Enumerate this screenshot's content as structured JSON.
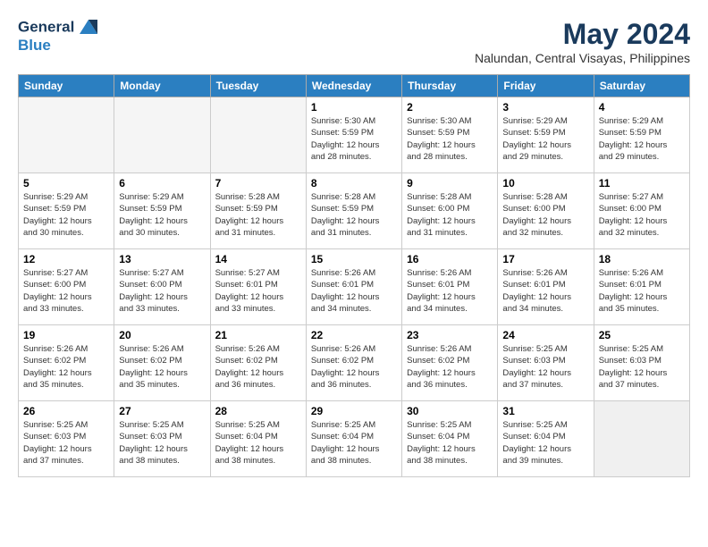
{
  "logo": {
    "line1": "General",
    "line2": "Blue"
  },
  "title": "May 2024",
  "location": "Nalundan, Central Visayas, Philippines",
  "days_of_week": [
    "Sunday",
    "Monday",
    "Tuesday",
    "Wednesday",
    "Thursday",
    "Friday",
    "Saturday"
  ],
  "weeks": [
    [
      {
        "day": "",
        "info": ""
      },
      {
        "day": "",
        "info": ""
      },
      {
        "day": "",
        "info": ""
      },
      {
        "day": "1",
        "info": "Sunrise: 5:30 AM\nSunset: 5:59 PM\nDaylight: 12 hours\nand 28 minutes."
      },
      {
        "day": "2",
        "info": "Sunrise: 5:30 AM\nSunset: 5:59 PM\nDaylight: 12 hours\nand 28 minutes."
      },
      {
        "day": "3",
        "info": "Sunrise: 5:29 AM\nSunset: 5:59 PM\nDaylight: 12 hours\nand 29 minutes."
      },
      {
        "day": "4",
        "info": "Sunrise: 5:29 AM\nSunset: 5:59 PM\nDaylight: 12 hours\nand 29 minutes."
      }
    ],
    [
      {
        "day": "5",
        "info": "Sunrise: 5:29 AM\nSunset: 5:59 PM\nDaylight: 12 hours\nand 30 minutes."
      },
      {
        "day": "6",
        "info": "Sunrise: 5:29 AM\nSunset: 5:59 PM\nDaylight: 12 hours\nand 30 minutes."
      },
      {
        "day": "7",
        "info": "Sunrise: 5:28 AM\nSunset: 5:59 PM\nDaylight: 12 hours\nand 31 minutes."
      },
      {
        "day": "8",
        "info": "Sunrise: 5:28 AM\nSunset: 5:59 PM\nDaylight: 12 hours\nand 31 minutes."
      },
      {
        "day": "9",
        "info": "Sunrise: 5:28 AM\nSunset: 6:00 PM\nDaylight: 12 hours\nand 31 minutes."
      },
      {
        "day": "10",
        "info": "Sunrise: 5:28 AM\nSunset: 6:00 PM\nDaylight: 12 hours\nand 32 minutes."
      },
      {
        "day": "11",
        "info": "Sunrise: 5:27 AM\nSunset: 6:00 PM\nDaylight: 12 hours\nand 32 minutes."
      }
    ],
    [
      {
        "day": "12",
        "info": "Sunrise: 5:27 AM\nSunset: 6:00 PM\nDaylight: 12 hours\nand 33 minutes."
      },
      {
        "day": "13",
        "info": "Sunrise: 5:27 AM\nSunset: 6:00 PM\nDaylight: 12 hours\nand 33 minutes."
      },
      {
        "day": "14",
        "info": "Sunrise: 5:27 AM\nSunset: 6:01 PM\nDaylight: 12 hours\nand 33 minutes."
      },
      {
        "day": "15",
        "info": "Sunrise: 5:26 AM\nSunset: 6:01 PM\nDaylight: 12 hours\nand 34 minutes."
      },
      {
        "day": "16",
        "info": "Sunrise: 5:26 AM\nSunset: 6:01 PM\nDaylight: 12 hours\nand 34 minutes."
      },
      {
        "day": "17",
        "info": "Sunrise: 5:26 AM\nSunset: 6:01 PM\nDaylight: 12 hours\nand 34 minutes."
      },
      {
        "day": "18",
        "info": "Sunrise: 5:26 AM\nSunset: 6:01 PM\nDaylight: 12 hours\nand 35 minutes."
      }
    ],
    [
      {
        "day": "19",
        "info": "Sunrise: 5:26 AM\nSunset: 6:02 PM\nDaylight: 12 hours\nand 35 minutes."
      },
      {
        "day": "20",
        "info": "Sunrise: 5:26 AM\nSunset: 6:02 PM\nDaylight: 12 hours\nand 35 minutes."
      },
      {
        "day": "21",
        "info": "Sunrise: 5:26 AM\nSunset: 6:02 PM\nDaylight: 12 hours\nand 36 minutes."
      },
      {
        "day": "22",
        "info": "Sunrise: 5:26 AM\nSunset: 6:02 PM\nDaylight: 12 hours\nand 36 minutes."
      },
      {
        "day": "23",
        "info": "Sunrise: 5:26 AM\nSunset: 6:02 PM\nDaylight: 12 hours\nand 36 minutes."
      },
      {
        "day": "24",
        "info": "Sunrise: 5:25 AM\nSunset: 6:03 PM\nDaylight: 12 hours\nand 37 minutes."
      },
      {
        "day": "25",
        "info": "Sunrise: 5:25 AM\nSunset: 6:03 PM\nDaylight: 12 hours\nand 37 minutes."
      }
    ],
    [
      {
        "day": "26",
        "info": "Sunrise: 5:25 AM\nSunset: 6:03 PM\nDaylight: 12 hours\nand 37 minutes."
      },
      {
        "day": "27",
        "info": "Sunrise: 5:25 AM\nSunset: 6:03 PM\nDaylight: 12 hours\nand 38 minutes."
      },
      {
        "day": "28",
        "info": "Sunrise: 5:25 AM\nSunset: 6:04 PM\nDaylight: 12 hours\nand 38 minutes."
      },
      {
        "day": "29",
        "info": "Sunrise: 5:25 AM\nSunset: 6:04 PM\nDaylight: 12 hours\nand 38 minutes."
      },
      {
        "day": "30",
        "info": "Sunrise: 5:25 AM\nSunset: 6:04 PM\nDaylight: 12 hours\nand 38 minutes."
      },
      {
        "day": "31",
        "info": "Sunrise: 5:25 AM\nSunset: 6:04 PM\nDaylight: 12 hours\nand 39 minutes."
      },
      {
        "day": "",
        "info": ""
      }
    ]
  ]
}
